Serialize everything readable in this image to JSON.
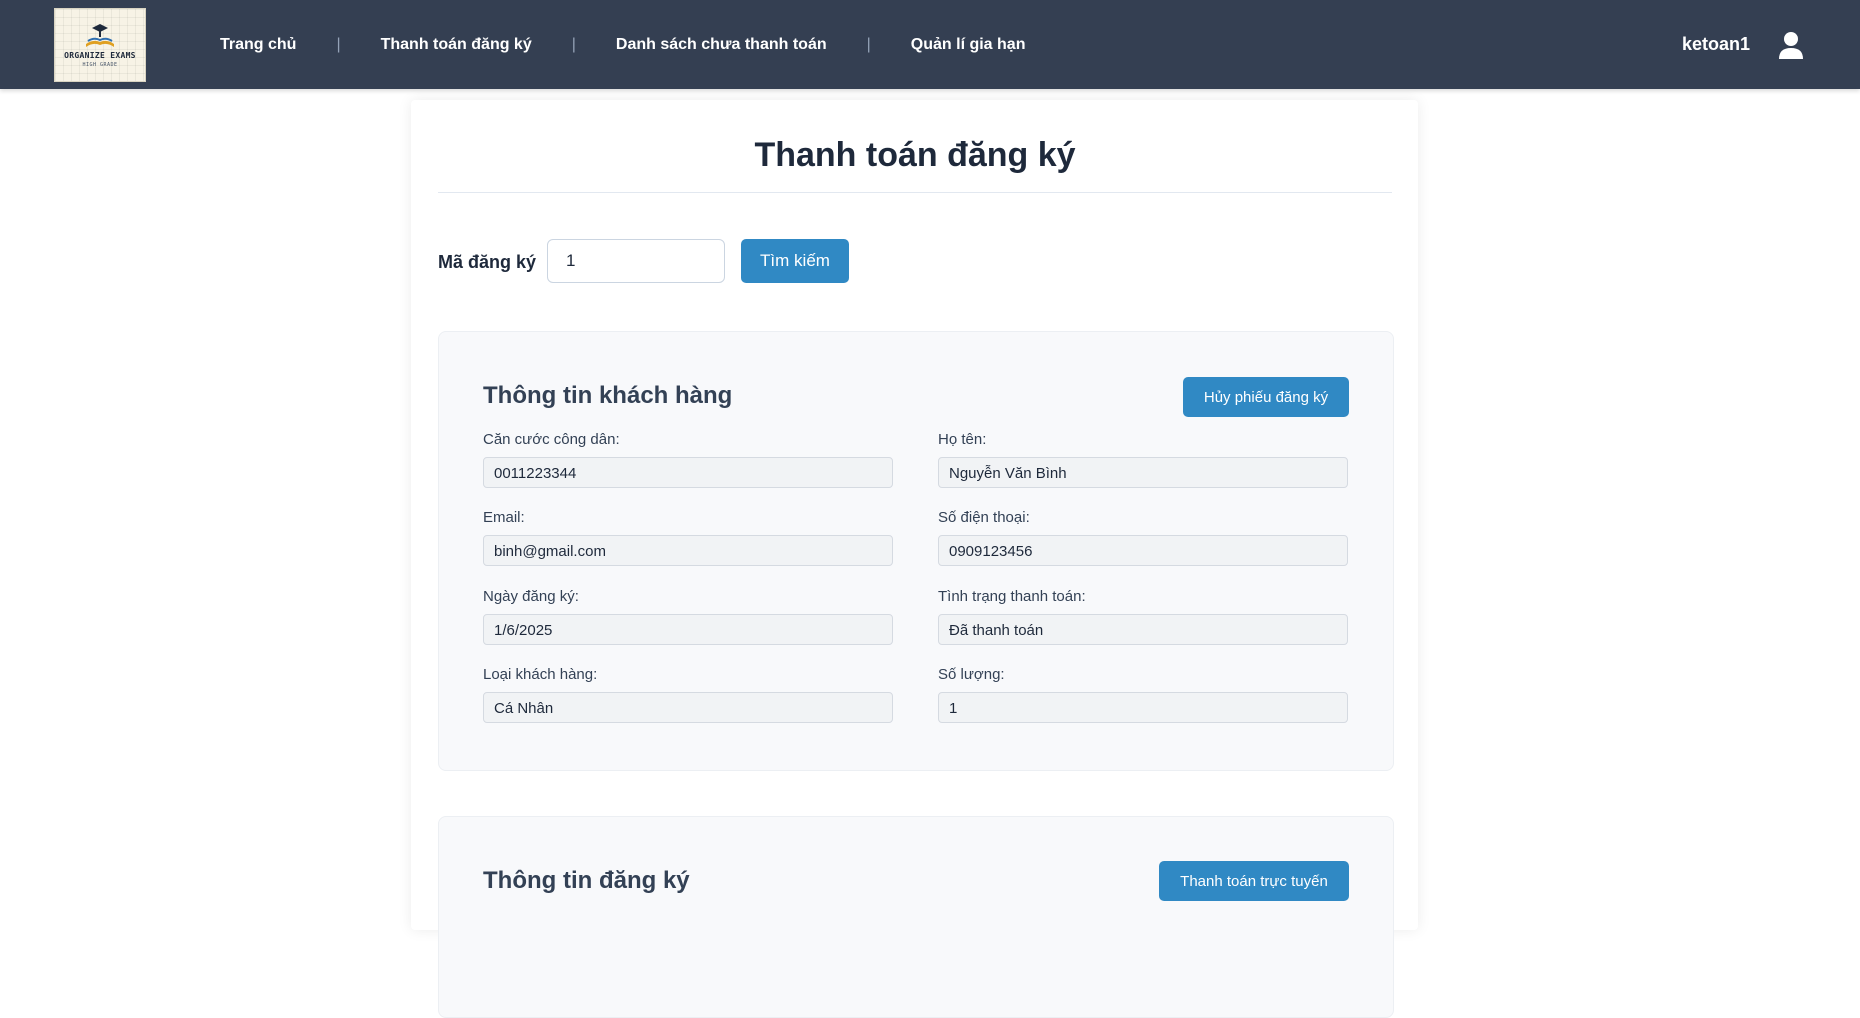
{
  "header": {
    "logo_text": "ORGANIZE EXAMS",
    "logo_sub": "HIGH GRADE",
    "nav": [
      {
        "label": "Trang chủ"
      },
      {
        "label": "Thanh toán đăng ký"
      },
      {
        "label": "Danh sách chưa thanh toán"
      },
      {
        "label": "Quản lí gia hạn"
      }
    ],
    "nav_separator": "|",
    "username": "ketoan1"
  },
  "page": {
    "title": "Thanh toán đăng ký",
    "search": {
      "label": "Mã đăng ký",
      "value": "1",
      "button": "Tìm kiếm"
    }
  },
  "customer_panel": {
    "title": "Thông tin khách hàng",
    "cancel_button": "Hủy phiếu đăng ký",
    "fields": [
      {
        "label": "Căn cước công dân:",
        "value": "0011223344"
      },
      {
        "label": "Họ tên:",
        "value": "Nguyễn Văn Bình"
      },
      {
        "label": "Email:",
        "value": "binh@gmail.com"
      },
      {
        "label": "Số điện thoại:",
        "value": "0909123456"
      },
      {
        "label": "Ngày đăng ký:",
        "value": "1/6/2025"
      },
      {
        "label": "Tình trạng thanh toán:",
        "value": "Đã thanh toán"
      },
      {
        "label": "Loại khách hàng:",
        "value": "Cá Nhân"
      },
      {
        "label": "Số lượng:",
        "value": "1"
      }
    ]
  },
  "registration_panel": {
    "title": "Thông tin đăng ký",
    "online_button": "Thanh toán trực tuyến"
  },
  "colors": {
    "header_bg": "#343f52",
    "primary": "#3089c4",
    "panel_bg": "#f8f9fb"
  }
}
